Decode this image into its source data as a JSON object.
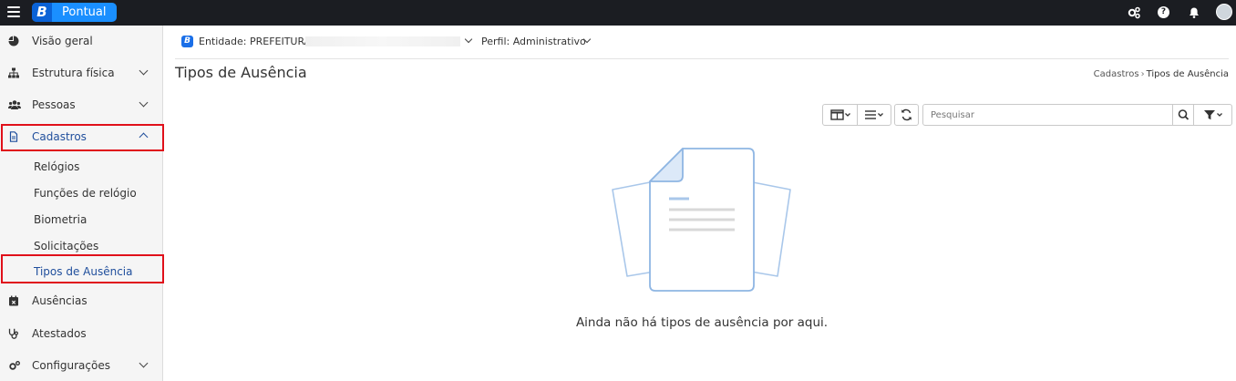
{
  "header": {
    "logo_mark": "B",
    "app_name": "Pontual",
    "icons": [
      "hamburger-icon",
      "gears-icon",
      "help-icon",
      "bell-icon",
      "avatar"
    ]
  },
  "sidebar": {
    "items": [
      {
        "label": "Visão geral",
        "icon": "chart-pie-icon"
      },
      {
        "label": "Estrutura física",
        "icon": "sitemap-icon"
      },
      {
        "label": "Pessoas",
        "icon": "users-icon"
      },
      {
        "label": "Cadastros",
        "icon": "file-icon"
      },
      {
        "label": "Ausências",
        "icon": "calendar-x-icon"
      },
      {
        "label": "Atestados",
        "icon": "stethoscope-icon"
      },
      {
        "label": "Configurações",
        "icon": "gears-icon"
      }
    ],
    "cadastros_subitems": [
      {
        "label": "Relógios"
      },
      {
        "label": "Funções de relógio"
      },
      {
        "label": "Biometria"
      },
      {
        "label": "Solicitações"
      },
      {
        "label": "Tipos de Ausência"
      }
    ]
  },
  "filters": {
    "entity_badge": "B",
    "entity_label": "Entidade: PREFEITURA",
    "profile_label": "Perfil: Administrativo"
  },
  "page": {
    "title": "Tipos de Ausência",
    "breadcrumb": [
      "Cadastros",
      "Tipos de Ausência"
    ],
    "search_placeholder": "Pesquisar",
    "empty_message": "Ainda não há tipos de ausência por aqui."
  },
  "colors": {
    "topbar": "#1b1d22",
    "brand": "#1a8fff",
    "active": "#1f4e9c",
    "highlight": "#e0101a"
  }
}
